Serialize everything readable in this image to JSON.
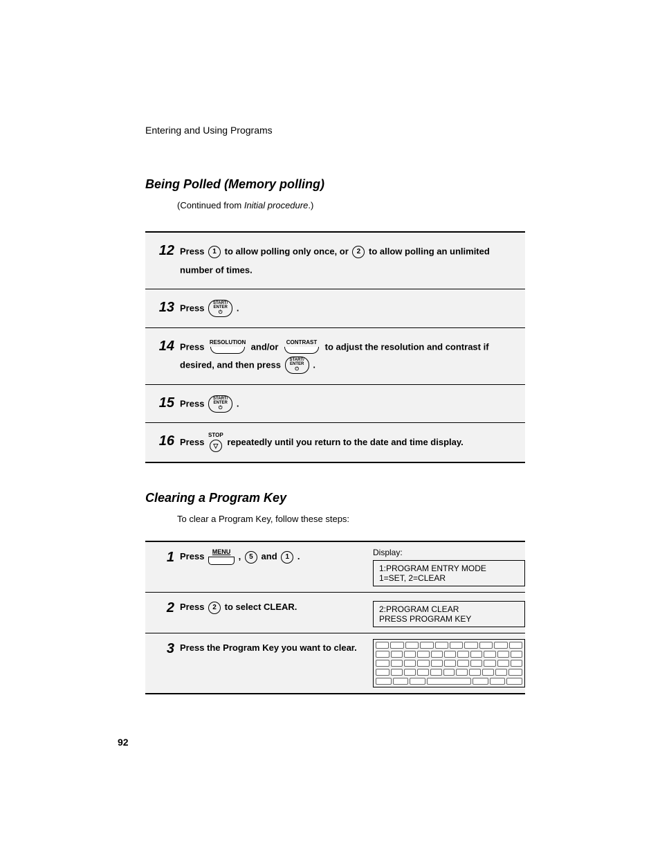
{
  "header": "Entering and Using Programs",
  "section1": {
    "title": "Being Polled (Memory polling)",
    "continued_pre": "(Continued from ",
    "continued_ital": "Initial procedure",
    "continued_post": ".)",
    "steps": [
      {
        "num": "12",
        "pre": "Press ",
        "key1": "1",
        "mid1": " to allow polling only once, or ",
        "key2": "2",
        "post": " to allow polling an unlimited number of times."
      },
      {
        "num": "13",
        "pre": "Press ",
        "oval_l1": "START/",
        "oval_l2": "ENTER",
        "post": "."
      },
      {
        "num": "14",
        "pre": "Press ",
        "label1": "RESOLUTION",
        "mid1": " and/or ",
        "label2": "CONTRAST",
        "mid2": " to adjust the resolution and contrast if desired, and then press ",
        "oval_l1": "START/",
        "oval_l2": "ENTER",
        "post": "."
      },
      {
        "num": "15",
        "pre": "Press ",
        "oval_l1": "START/",
        "oval_l2": "ENTER",
        "post": "."
      },
      {
        "num": "16",
        "pre": "Press ",
        "stop_label": "STOP",
        "post": " repeatedly until you return to the date and time display."
      }
    ]
  },
  "section2": {
    "title": "Clearing a Program Key",
    "intro": "To clear a Program Key, follow these steps:",
    "display_label": "Display:",
    "steps": [
      {
        "num": "1",
        "pre": "Press ",
        "menu_label": "MENU",
        "mid1": " , ",
        "key1": "5",
        "mid2": " and ",
        "key2": "1",
        "post": " .",
        "display_line1": "1:PROGRAM ENTRY MODE",
        "display_line2": "1=SET, 2=CLEAR"
      },
      {
        "num": "2",
        "pre": "Press ",
        "key1": "2",
        "post": " to select CLEAR.",
        "display_line1": "2:PROGRAM CLEAR",
        "display_line2": "PRESS PROGRAM KEY"
      },
      {
        "num": "3",
        "text": "Press the Program Key you want to clear."
      }
    ]
  },
  "page_number": "92"
}
